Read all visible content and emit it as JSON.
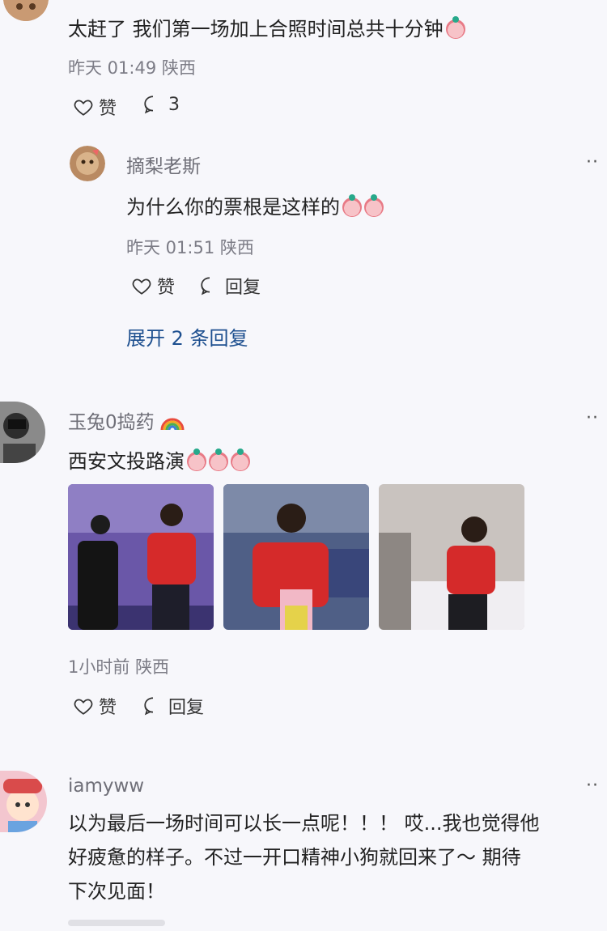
{
  "comment1": {
    "text": "太赶了 我们第一场加上合照时间总共十分钟",
    "time": "昨天 01:49",
    "location": "陕西",
    "like_label": "赞",
    "reply_count": "3",
    "reply": {
      "user": "摘梨老斯",
      "text": "为什么你的票根是这样的",
      "time": "昨天 01:51",
      "location": "陕西",
      "like_label": "赞",
      "reply_label": "回复"
    },
    "expand_label": "展开 2 条回复"
  },
  "comment2": {
    "user": "玉兔0捣药",
    "text": "西安文投路演",
    "time": "1小时前",
    "location": "陕西",
    "like_label": "赞",
    "reply_label": "回复"
  },
  "comment3": {
    "user": "iamyww",
    "line1": "以为最后一场时间可以长一点呢！！！ 哎...我也觉得他",
    "line2": "好疲惫的样子。不过一开口精神小狗就回来了～ 期待",
    "line3": "下次见面！"
  },
  "more_label": "··",
  "icons": {
    "like": "heart-outline-icon",
    "comment": "comment-bubble-icon"
  }
}
